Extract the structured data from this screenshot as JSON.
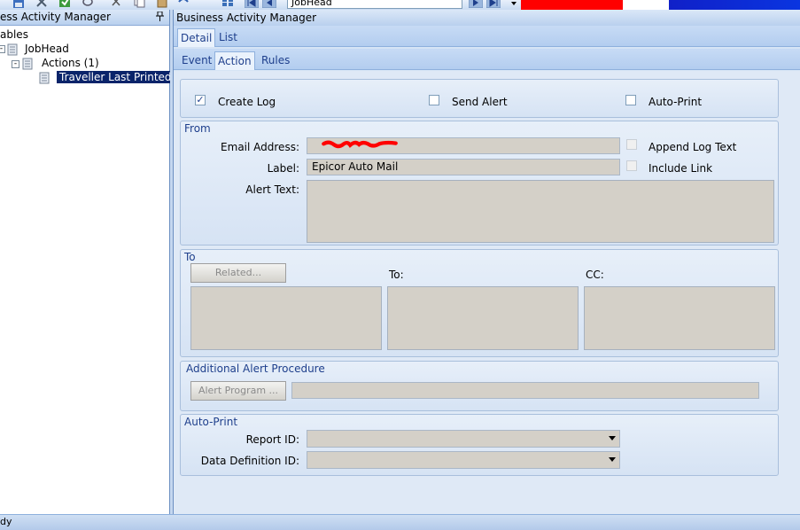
{
  "toolbar": {
    "combo_value": "JobHead",
    "icons": [
      "save-icon",
      "delete-icon",
      "refresh-icon",
      "clear-icon",
      "cut-icon",
      "copy-icon",
      "paste-icon",
      "undo-icon",
      "view-icon",
      "first-record-icon",
      "prev-record-icon",
      "next-record-icon",
      "last-record-icon"
    ]
  },
  "left_pane": {
    "title": "ess Activity Manager",
    "pin": "Ű",
    "tree": {
      "root": "ables",
      "table": "JobHead",
      "actions": "Actions (1)",
      "selected_action": "Traveller Last Printed"
    }
  },
  "right_pane": {
    "title": "Business Activity Manager",
    "tabs_top": [
      "Detail",
      "List"
    ],
    "tabs_sub": [
      "Event",
      "Action",
      "Rules"
    ],
    "active_top_tab": "Detail",
    "active_sub_tab": "Action"
  },
  "options": {
    "create_log": {
      "label": "Create Log",
      "checked": true
    },
    "send_alert": {
      "label": "Send Alert",
      "checked": false
    },
    "auto_print": {
      "label": "Auto-Print",
      "checked": false
    }
  },
  "from": {
    "group_title": "From",
    "email_label": "Email Address:",
    "email_value": "",
    "label_label": "Label:",
    "label_value": "Epicor Auto Mail",
    "alert_text_label": "Alert Text:",
    "alert_text_value": "",
    "append_log_text": {
      "label": "Append Log Text",
      "checked": false
    },
    "include_link": {
      "label": "Include Link",
      "checked": false
    }
  },
  "to": {
    "group_title": "To",
    "related_button": "Related...",
    "to_label": "To:",
    "cc_label": "CC:"
  },
  "alert_procedure": {
    "group_title": "Additional Alert Procedure",
    "button": "Alert Program ...",
    "value": ""
  },
  "auto_print_group": {
    "group_title": "Auto-Print",
    "report_id_label": "Report ID:",
    "report_id_value": "",
    "data_def_label": "Data Definition ID:",
    "data_def_value": ""
  },
  "status": {
    "text": "dy"
  },
  "colors": {
    "accent": "#1e3f8c",
    "selection": "#0a246a",
    "redaction": "#ff0000"
  }
}
